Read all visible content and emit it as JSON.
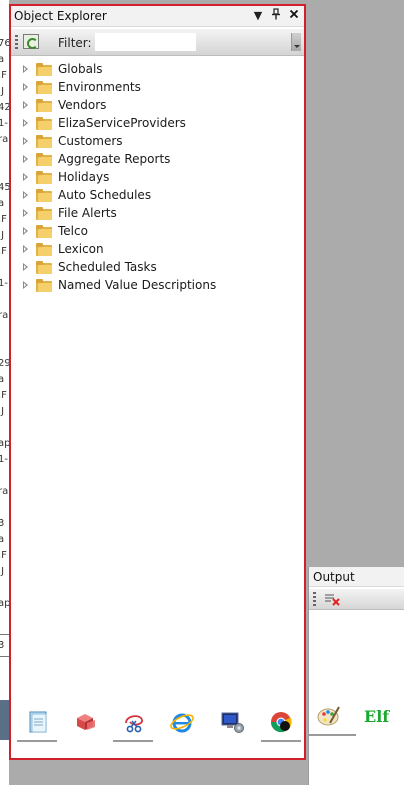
{
  "explorer": {
    "title": "Object Explorer",
    "filter_label": "Filter:",
    "filter_value": "",
    "items": [
      {
        "label": "Globals"
      },
      {
        "label": "Environments"
      },
      {
        "label": "Vendors"
      },
      {
        "label": "ElizaServiceProviders"
      },
      {
        "label": "Customers"
      },
      {
        "label": "Aggregate Reports"
      },
      {
        "label": "Holidays"
      },
      {
        "label": "Auto Schedules"
      },
      {
        "label": "File Alerts"
      },
      {
        "label": "Telco"
      },
      {
        "label": "Lexicon"
      },
      {
        "label": "Scheduled Tasks"
      },
      {
        "label": "Named Value Descriptions"
      }
    ],
    "bottom_icons": [
      "notepad-icon",
      "package-icon",
      "scissors-tool-icon",
      "internet-explorer-icon",
      "network-computer-icon",
      "chrome-icon"
    ]
  },
  "output": {
    "title": "Output",
    "bottom_icons": [
      "paint-palette-icon",
      "elf-icon"
    ],
    "elf_text": "Elf"
  },
  "left_strip": [
    "76",
    "a",
    ".F",
    ".J",
    "42",
    "1-",
    "ra",
    "45",
    "a",
    ".F",
    ".J",
    ".F",
    "1-",
    "ra",
    "29",
    "a",
    ".F",
    ".J",
    "ap",
    "1-",
    "ra",
    "3",
    "a",
    ".F",
    ".J",
    "ap",
    "3"
  ],
  "colors": {
    "highlight_border": "#d0202a",
    "folder": "#f4cf6a",
    "elf_green": "#1aa82e"
  }
}
